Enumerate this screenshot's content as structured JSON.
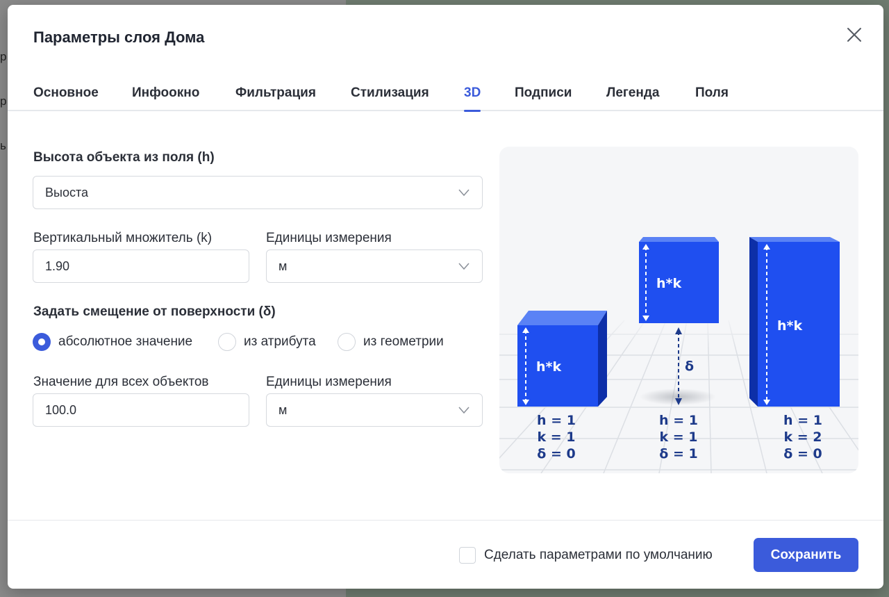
{
  "background": {
    "left_fragments": [
      "р",
      "р",
      "ь"
    ]
  },
  "modal": {
    "title": "Параметры слоя Дома",
    "close_icon": "close-icon"
  },
  "tabs": [
    {
      "label": "Основное",
      "active": false
    },
    {
      "label": "Инфоокно",
      "active": false
    },
    {
      "label": "Фильтрация",
      "active": false
    },
    {
      "label": "Стилизация",
      "active": false
    },
    {
      "label": "3D",
      "active": true
    },
    {
      "label": "Подписи",
      "active": false
    },
    {
      "label": "Легенда",
      "active": false
    },
    {
      "label": "Поля",
      "active": false
    }
  ],
  "form": {
    "height_field_label": "Высота объекта из поля (h)",
    "height_field_value": "Выоста",
    "multiplier_label": "Вертикальный множитель (k)",
    "multiplier_value": "1.90",
    "units_label_1": "Единицы измерения",
    "units_value_1": "м",
    "offset_label": "Задать смещение от поверхности (δ)",
    "offset_options": [
      {
        "label": "абсолютное значение",
        "selected": true
      },
      {
        "label": "из атрибута",
        "selected": false
      },
      {
        "label": "из геометрии",
        "selected": false
      }
    ],
    "all_objects_label": "Значение для всех объектов",
    "all_objects_value": "100.0",
    "units_label_2": "Единицы измерения",
    "units_value_2": "м"
  },
  "illustration": {
    "box1": {
      "tag": "h*k",
      "h": "h = 1",
      "k": "k = 1",
      "d": "δ = 0"
    },
    "box2": {
      "tag": "h*k",
      "gap_tag": "δ",
      "h": "h = 1",
      "k": "k = 1",
      "d": "δ = 1"
    },
    "box3": {
      "tag": "h*k",
      "h": "h = 1",
      "k": "k = 2",
      "d": "δ = 0"
    },
    "colors": {
      "box_front": "#1f4ff0",
      "box_top": "#5a82f5",
      "box_side": "#0d2fa8",
      "text": "#1d3a8a"
    }
  },
  "footer": {
    "default_checkbox_label": "Сделать параметрами по умолчанию",
    "default_checked": false,
    "save_label": "Сохранить"
  },
  "colors": {
    "accent": "#3b5bdb"
  }
}
